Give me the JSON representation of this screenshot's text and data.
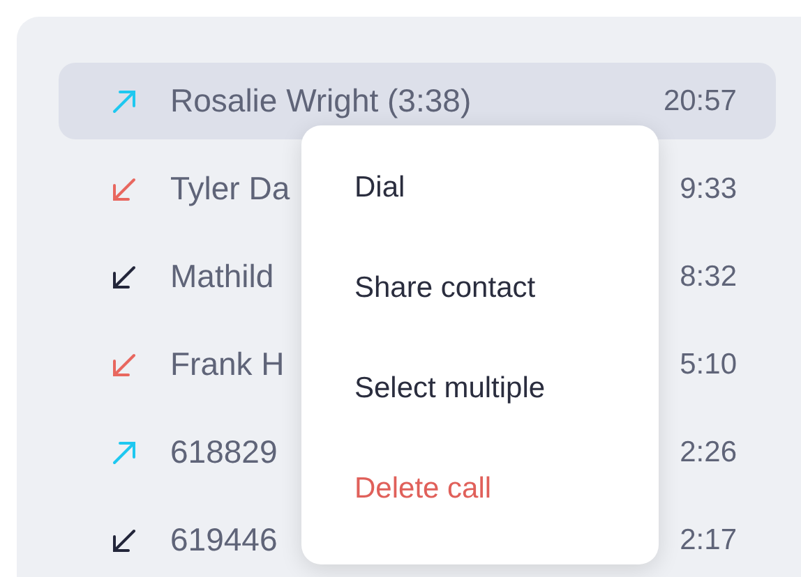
{
  "calls": [
    {
      "kind": "outgoing",
      "name": "Rosalie Wright (3:38)",
      "time": "20:57",
      "selected": true
    },
    {
      "kind": "missed",
      "name": "Tyler Da",
      "time": "9:33",
      "selected": false
    },
    {
      "kind": "incoming",
      "name": "Mathild",
      "time": "8:32",
      "selected": false
    },
    {
      "kind": "missed",
      "name": "Frank H",
      "time": "5:10",
      "selected": false
    },
    {
      "kind": "outgoing",
      "name": "618829",
      "time": "2:26",
      "selected": false
    },
    {
      "kind": "incoming",
      "name": "619446",
      "time": "2:17",
      "selected": false
    }
  ],
  "context_menu": {
    "items": [
      {
        "label": "Dial",
        "kind": "normal"
      },
      {
        "label": "Share contact",
        "kind": "normal"
      },
      {
        "label": "Select multiple",
        "kind": "normal"
      },
      {
        "label": "Delete call",
        "kind": "danger"
      }
    ]
  }
}
